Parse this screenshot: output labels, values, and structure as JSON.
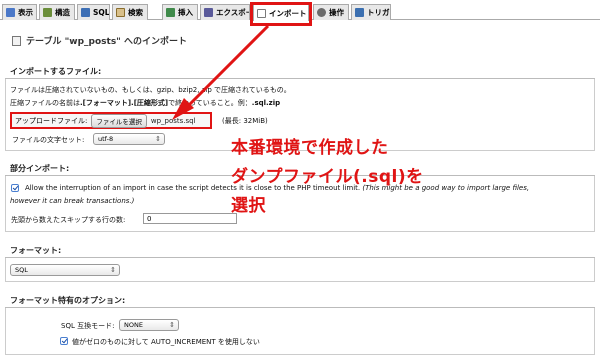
{
  "tabs": [
    {
      "label": "表示",
      "icon": "table-icon",
      "color": "#4b78c8"
    },
    {
      "label": "構造",
      "icon": "structure-icon",
      "color": "#6b8e3a"
    },
    {
      "label": "SQL",
      "icon": "sql-icon",
      "color": "#3d6fb5"
    },
    {
      "label": "検索",
      "icon": "search-icon",
      "color": "#8a6d2c"
    },
    {
      "label": "挿入",
      "icon": "insert-icon",
      "color": "#3f8a4a"
    },
    {
      "label": "エクスポート",
      "icon": "export-icon",
      "color": "#5a5a9a"
    },
    {
      "label": "インポート",
      "icon": "import-icon",
      "color": "#7a7a7a"
    },
    {
      "label": "操作",
      "icon": "operations-icon",
      "color": "#6a6a6a"
    },
    {
      "label": "トリガ",
      "icon": "triggers-icon",
      "color": "#3b6fb0"
    }
  ],
  "page": {
    "title": "テーブル \"wp_posts\" へのインポート"
  },
  "file_section": {
    "legend": "インポートするファイル:",
    "line1": "ファイルは圧縮されていないもの、もしくは、gzip、bzip2, zip で圧縮されているもの。",
    "line2_prefix": "圧縮ファイルの名前は",
    "line2_bold": ".[フォーマット].[圧縮形式]",
    "line2_suffix": "で終わっていること。例：",
    "line2_example": ".sql.zip",
    "upload_label": "アップロードファイル:",
    "upload_button": "ファイルを選択",
    "upload_file": "wp_posts.sql",
    "max_size": "(最長: 32MiB)",
    "charset_label": "ファイルの文字セット:",
    "charset_value": "utf-8"
  },
  "partial_section": {
    "legend": "部分インポート:",
    "allow_text": "Allow the interruption of an import in case the script detects it is close to the PHP timeout limit.",
    "allow_italic1": "(This might be a good way to import large files,",
    "allow_italic2": "however it can break transactions.)",
    "skip_label": "先頭から数えたスキップする行の数:",
    "skip_value": "0"
  },
  "format_section": {
    "legend": "フォーマット:",
    "value": "SQL"
  },
  "options_section": {
    "legend": "フォーマット特有のオプション:",
    "compat_label": "SQL 互換モード:",
    "compat_value": "NONE",
    "auto_inc": "値がゼロのものに対して AUTO_INCREMENT を使用しない"
  },
  "annotation": {
    "line1": "本番環境で作成した",
    "line2": "ダンプファイル(.sql)を",
    "line3": "選択",
    "color": "#e01414"
  }
}
